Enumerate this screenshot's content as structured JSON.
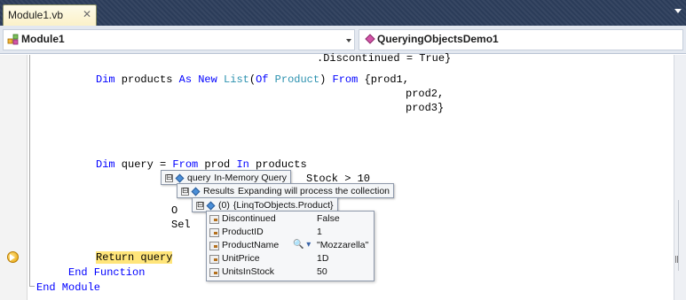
{
  "tab": {
    "title": "Module1.vb",
    "close_glyph": "✕"
  },
  "navbar": {
    "left_label": "Module1",
    "right_label": "QueryingObjectsDemo1"
  },
  "code": {
    "line_top": ".Discontinued = True}",
    "products_kw1": "Dim",
    "products_var": " products ",
    "products_kw2": "As New",
    "products_type": "List",
    "products_paren": "(",
    "products_kw3": "Of",
    "products_type2": "Product",
    "products_mid": ") ",
    "products_kw4": "From",
    "products_rest": " {prod1,",
    "prod2": "prod2,",
    "prod3": "prod3}",
    "query_kw1": "Dim",
    "query_var": " query = ",
    "query_kw2": "From",
    "query_mid": " prod ",
    "query_kw3": "In",
    "query_rest": " products",
    "stock_fragment": "Stock > 10",
    "order_fragment": "O",
    "select_fragment": "Sel",
    "return_line": "Return query",
    "end_function": "End Function",
    "end_module": "End Module"
  },
  "datatip": {
    "query": {
      "name": "query",
      "value": "In-Memory Query"
    },
    "results": {
      "name": "Results",
      "value": "Expanding will process the collection"
    },
    "item0": {
      "name": "(0)",
      "value": "{LinqToObjects.Product}"
    },
    "expand_glyph": "⊟",
    "properties": [
      {
        "name": "Discontinued",
        "value": "False"
      },
      {
        "name": "ProductID",
        "value": "1"
      },
      {
        "name": "ProductName",
        "value": "\"Mozzarella\""
      },
      {
        "name": "UnitPrice",
        "value": "1D"
      },
      {
        "name": "UnitsInStock",
        "value": "50"
      }
    ],
    "visualizer_glyph": "🔍 ▾"
  },
  "colors": {
    "keyword": "#0000ff",
    "type": "#2b91af",
    "highlight": "#ffe57a",
    "tab_bg": "#2b3c59"
  }
}
